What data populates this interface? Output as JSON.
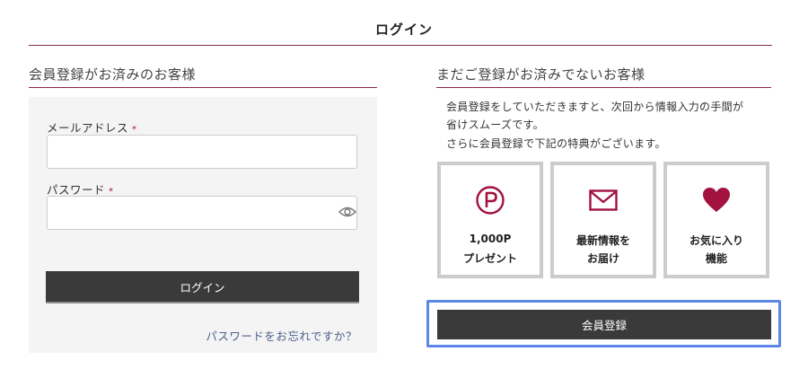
{
  "page": {
    "title": "ログイン"
  },
  "colors": {
    "accent": "#8b2a3e",
    "brand_icon": "#a3123e",
    "button_bg": "#3a3a3a",
    "link": "#4d5f8c",
    "highlight": "#5b86e5"
  },
  "member_login": {
    "heading": "会員登録がお済みのお客様",
    "email": {
      "label": "メールアドレス",
      "required_mark": "*",
      "value": ""
    },
    "password": {
      "label": "パスワード",
      "required_mark": "*",
      "value": "",
      "toggle_icon": "eye-icon"
    },
    "login_button": "ログイン",
    "forgot_link": "パスワードをお忘れですか？"
  },
  "new_member": {
    "heading": "まだご登録がお済みでないお客様",
    "description": [
      "会員登録をしていただきますと、次回から情報入力の手間が",
      "省けスムーズです。",
      "さらに会員登録で下記の特典がございます。"
    ],
    "benefits": [
      {
        "icon": "points-p-icon",
        "line1": "1,000P",
        "line2": "プレゼント"
      },
      {
        "icon": "mail-icon",
        "line1": "最新情報を",
        "line2": "お届け"
      },
      {
        "icon": "heart-icon",
        "line1": "お気に入り",
        "line2": "機能"
      }
    ],
    "register_button": "会員登録"
  }
}
